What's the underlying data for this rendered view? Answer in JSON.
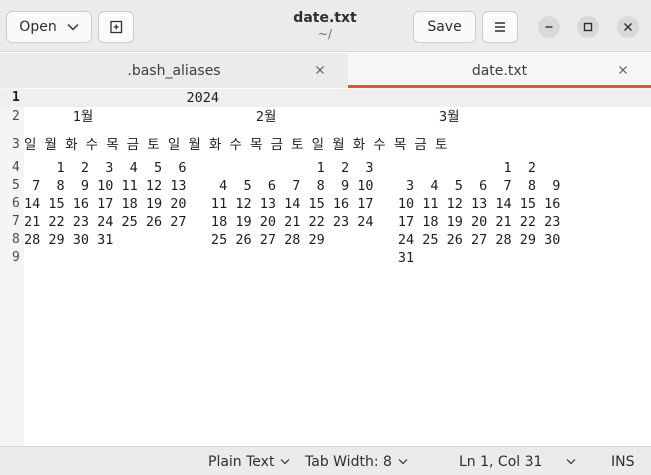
{
  "header": {
    "open_label": "Open",
    "save_label": "Save",
    "title": "date.txt",
    "subtitle": "~/"
  },
  "tabs": [
    {
      "label": ".bash_aliases",
      "active": false
    },
    {
      "label": "date.txt",
      "active": true
    }
  ],
  "editor": {
    "lines": [
      {
        "number": "1",
        "text": "                    2024"
      },
      {
        "number": "2",
        "text": "      1월                    2월                    3월"
      },
      {
        "number": "3",
        "text": "일 월 화 수 목 금 토 일 월 화 수 목 금 토 일 월 화 수 목 금 토"
      },
      {
        "number": "4",
        "text": "    1  2  3  4  5  6                1  2  3                1  2"
      },
      {
        "number": "5",
        "text": " 7  8  9 10 11 12 13    4  5  6  7  8  9 10    3  4  5  6  7  8  9"
      },
      {
        "number": "6",
        "text": "14 15 16 17 18 19 20   11 12 13 14 15 16 17   10 11 12 13 14 15 16"
      },
      {
        "number": "7",
        "text": "21 22 23 24 25 26 27   18 19 20 21 22 23 24   17 18 19 20 21 22 23"
      },
      {
        "number": "8",
        "text": "28 29 30 31            25 26 27 28 29         24 25 26 27 28 29 30"
      },
      {
        "number": "9",
        "text": "                                              31"
      }
    ]
  },
  "statusbar": {
    "language": "Plain Text",
    "tab_width": "Tab Width: 8",
    "position": "Ln 1, Col 31",
    "mode": "INS"
  },
  "colors": {
    "accent": "#e95420",
    "header_bg": "#ebebeb",
    "gutter_bg": "#f5f5f5"
  },
  "icons": {
    "open_dropdown": "chevron-down-icon",
    "new_tab": "new-tab-icon",
    "menu": "hamburger-menu-icon",
    "minimize": "minimize-icon",
    "maximize": "maximize-icon",
    "close": "close-icon",
    "tab_close": "close-icon"
  }
}
